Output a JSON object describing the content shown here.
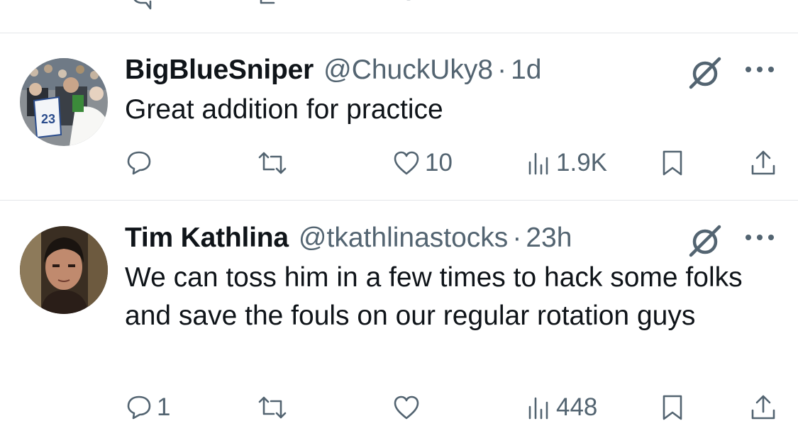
{
  "tweets": [
    {
      "name": "BigBlueSniper",
      "handle": "@ChuckUky8",
      "separator": "·",
      "time": "1d",
      "text": "Great addition for practice",
      "stats": {
        "replies": "",
        "reposts": "",
        "likes": "10",
        "views": "1.9K"
      }
    },
    {
      "name": "Tim Kathlina",
      "handle": "@tkathlinastocks",
      "separator": "·",
      "time": "23h",
      "text": "We can toss him in a few times to hack some folks and save the fouls on our regular rotation guys",
      "stats": {
        "replies": "1",
        "reposts": "",
        "likes": "",
        "views": "448"
      }
    }
  ],
  "icons": {
    "reply": "reply-icon",
    "repost": "repost-icon",
    "like": "heart-icon",
    "views": "views-icon",
    "bookmark": "bookmark-icon",
    "share": "share-icon",
    "grok": "grok-icon",
    "more": "more-icon"
  },
  "colors": {
    "text": "#0f1419",
    "secondary": "#536471",
    "divider": "#e3e6e9"
  }
}
